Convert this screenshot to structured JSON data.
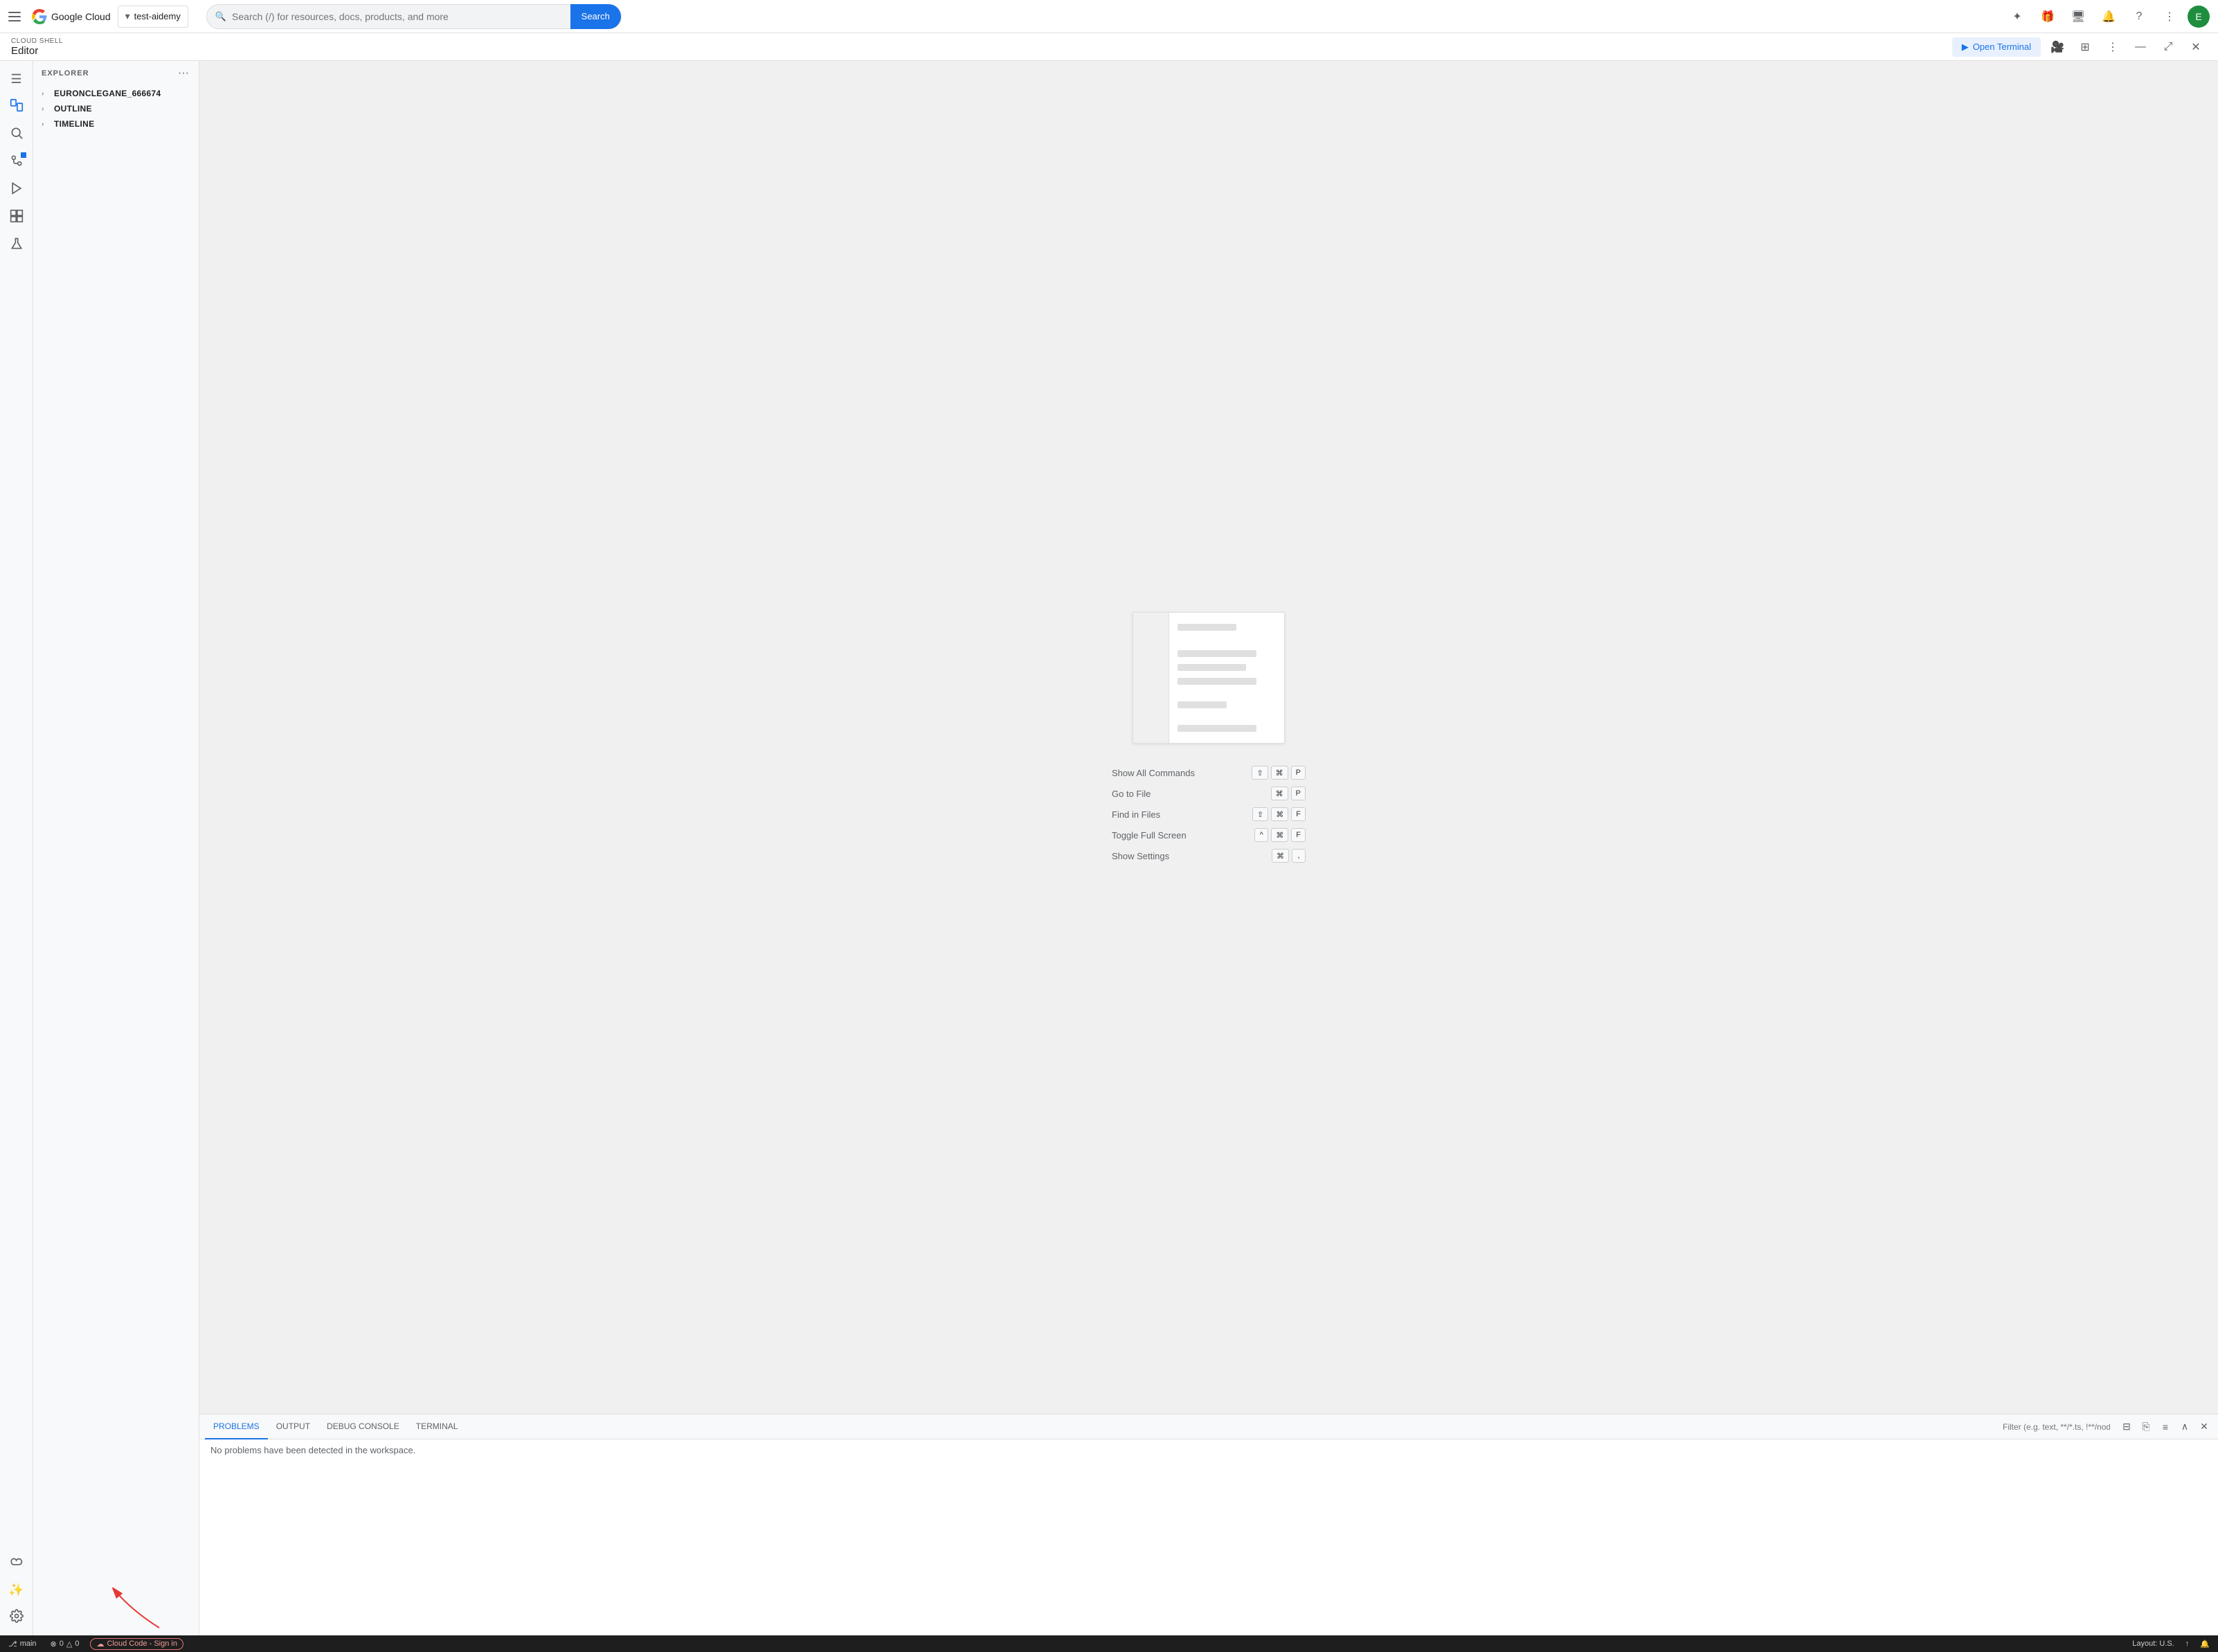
{
  "topNav": {
    "hamburger_label": "☰",
    "brand": "Google Cloud",
    "project_chip": "test-aidemy",
    "search_placeholder": "Search (/) for resources, docs, products, and more",
    "search_button": "Search",
    "icons": [
      "extension-icon",
      "gift-icon",
      "monitor-icon",
      "bell-icon",
      "help-icon",
      "more-icon"
    ],
    "avatar_letter": "E"
  },
  "shellHeader": {
    "shell_label": "CLOUD SHELL",
    "editor_title": "Editor",
    "open_terminal_btn": "Open Terminal"
  },
  "sidebar": {
    "title": "EXPLORER",
    "items": [
      {
        "label": "EURONCLEGANE_666674",
        "arrow": "›"
      },
      {
        "label": "OUTLINE",
        "arrow": "›"
      },
      {
        "label": "TIMELINE",
        "arrow": "›"
      }
    ]
  },
  "activityBar": {
    "icons": [
      {
        "name": "menu-icon",
        "symbol": "☰",
        "active": false
      },
      {
        "name": "files-icon",
        "symbol": "⎘",
        "active": true,
        "badge": false
      },
      {
        "name": "search-icon",
        "symbol": "🔍",
        "active": false
      },
      {
        "name": "source-control-icon",
        "symbol": "⎇",
        "active": false,
        "badge": true
      },
      {
        "name": "run-icon",
        "symbol": "▶",
        "active": false
      },
      {
        "name": "extensions-icon",
        "symbol": "⧉",
        "active": false
      },
      {
        "name": "flask-icon",
        "symbol": "⚗",
        "active": false
      },
      {
        "name": "puzzle-icon",
        "symbol": "✦",
        "active": false
      },
      {
        "name": "star-icon",
        "symbol": "✨",
        "active": false
      }
    ]
  },
  "welcome": {
    "preview_lines": [
      {
        "width": "60%"
      },
      {
        "width": "80%"
      },
      {
        "width": "70%"
      },
      {
        "width": "80%"
      },
      {
        "width": "50%"
      },
      {
        "width": "80%"
      }
    ],
    "shortcuts": [
      {
        "label": "Show All Commands",
        "keys": [
          "⇧",
          "⌘",
          "P"
        ]
      },
      {
        "label": "Go to File",
        "keys": [
          "⌘",
          "P"
        ]
      },
      {
        "label": "Find in Files",
        "keys": [
          "⇧",
          "⌘",
          "F"
        ]
      },
      {
        "label": "Toggle Full Screen",
        "keys": [
          "^",
          "⌘",
          "F"
        ]
      },
      {
        "label": "Show Settings",
        "keys": [
          "⌘",
          ","
        ]
      }
    ]
  },
  "bottomPanel": {
    "tabs": [
      {
        "label": "PROBLEMS",
        "active": true
      },
      {
        "label": "OUTPUT",
        "active": false
      },
      {
        "label": "DEBUG CONSOLE",
        "active": false
      },
      {
        "label": "TERMINAL",
        "active": false
      }
    ],
    "filter_placeholder": "Filter (e.g. text, **/*.ts, !**/node_modules/**)",
    "no_problems_msg": "No problems have been detected in the workspace."
  },
  "statusBar": {
    "branch": "main",
    "errors": "0",
    "warnings": "0",
    "cloud_code_label": "Cloud Code - Sign in",
    "layout": "Layout: U.S."
  }
}
